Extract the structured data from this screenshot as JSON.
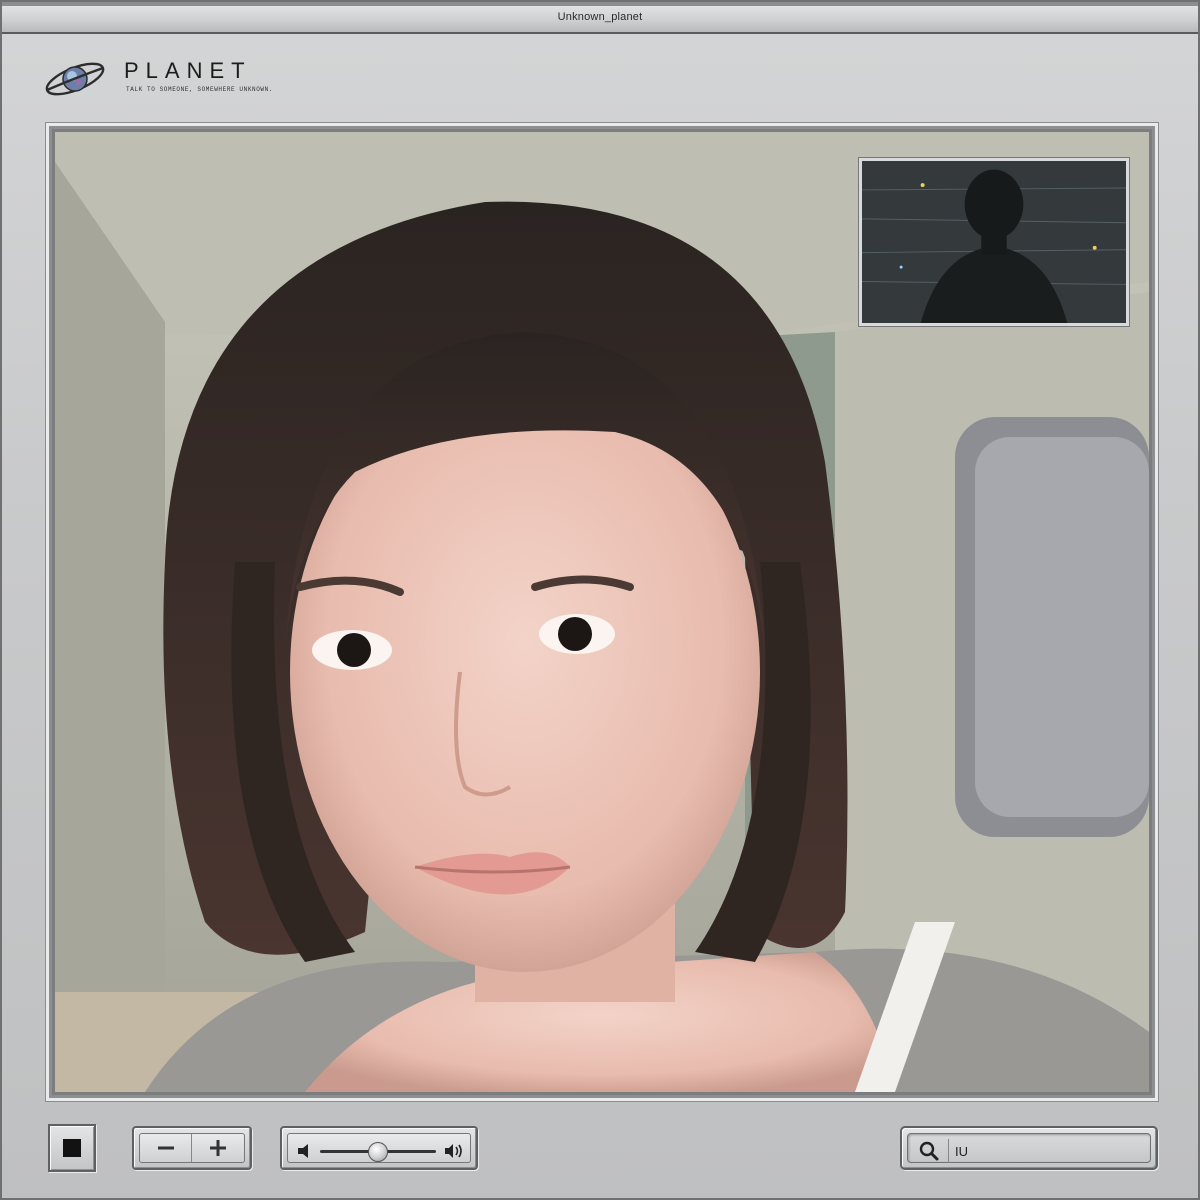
{
  "window": {
    "title": "Unknown_planet"
  },
  "brand": {
    "name": "PLANET",
    "tagline": "TALK TO SOMEONE, SOMEWHERE UNKNOWN.",
    "logo_icon": "planet-orbit-icon"
  },
  "controls": {
    "stop_icon": "stop-icon",
    "zoom_out_icon": "minus-icon",
    "zoom_in_icon": "plus-icon",
    "volume_low_icon": "speaker-low-icon",
    "volume_high_icon": "speaker-high-icon",
    "volume_level": 0.5,
    "search_icon": "magnifier-icon",
    "search_value": "IU"
  },
  "colors": {
    "chrome": "#c9cacb",
    "frame_border": "#e9eaeb",
    "text": "#1c1c1c"
  }
}
